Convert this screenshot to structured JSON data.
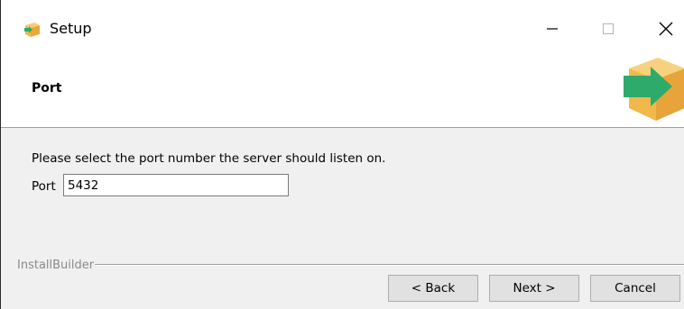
{
  "window": {
    "title": "Setup",
    "icons": {
      "app": "installer-box-icon",
      "minimize": "minimize-icon",
      "maximize": "maximize-icon",
      "close": "close-icon"
    }
  },
  "header": {
    "heading": "Port",
    "banner_icon": "installer-box-arrow-icon"
  },
  "body": {
    "instruction": "Please select the port number the server should listen on.",
    "port_label": "Port",
    "port_value": "5432"
  },
  "footer": {
    "brand": "InstallBuilder",
    "back_label": "< Back",
    "next_label": "Next >",
    "cancel_label": "Cancel"
  },
  "colors": {
    "box_orange": "#f2b84b",
    "arrow_green": "#2eaa6b"
  }
}
